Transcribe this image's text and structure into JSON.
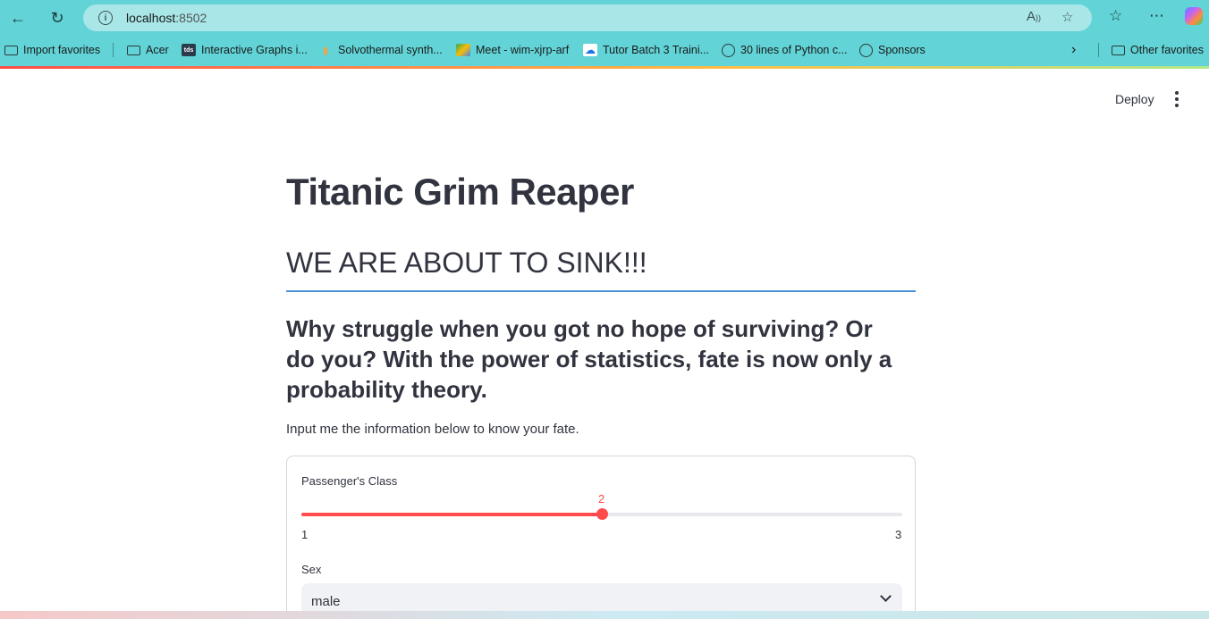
{
  "browser": {
    "url_host": "localhost",
    "url_port": ":8502",
    "bookmarks": [
      {
        "label": "Import favorites",
        "icon": "import-icon"
      },
      {
        "label": "Acer",
        "icon": "folder-icon"
      },
      {
        "label": "Interactive Graphs i...",
        "icon": "tds-icon",
        "icon_text": "tds"
      },
      {
        "label": "Solvothermal synth...",
        "icon": "page-icon"
      },
      {
        "label": "Meet - wim-xjrp-arf",
        "icon": "meet-icon"
      },
      {
        "label": "Tutor Batch 3 Traini...",
        "icon": "cloud-icon"
      },
      {
        "label": "30 lines of Python c...",
        "icon": "globe-icon"
      },
      {
        "label": "Sponsors",
        "icon": "globe-icon"
      }
    ],
    "other_favorites": "Other favorites"
  },
  "app": {
    "deploy_label": "Deploy",
    "title": "Titanic Grim Reaper",
    "header": "WE ARE ABOUT TO SINK!!!",
    "subheader": "Why struggle when you got no hope of surviving? Or do you? With the power of statistics, fate is now only a probability theory.",
    "intro": "Input me the information below to know your fate.",
    "form": {
      "pclass_label": "Passenger's Class",
      "pclass_value": "2",
      "pclass_min": "1",
      "pclass_max": "3",
      "pclass_fraction": 0.5,
      "sex_label": "Sex",
      "sex_value": "male"
    }
  },
  "colors": {
    "accent": "#ff4b4b",
    "divider": "#4a90d9",
    "text": "#31333f",
    "chrome": "#62d3d6"
  }
}
